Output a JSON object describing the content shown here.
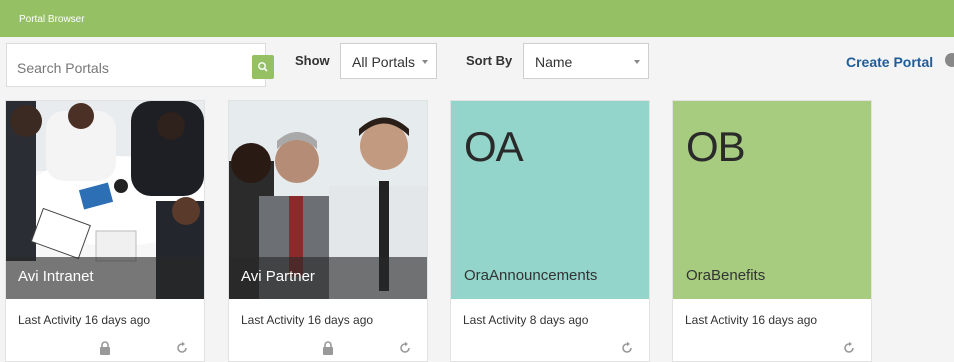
{
  "window": {
    "title": "Portal Browser"
  },
  "search": {
    "placeholder": "Search Portals",
    "value": ""
  },
  "filters": {
    "show_label": "Show",
    "show_value": "All Portals",
    "sort_label": "Sort By",
    "sort_value": "Name"
  },
  "actions": {
    "create_portal": "Create Portal"
  },
  "portals": [
    {
      "name": "Avi Intranet",
      "activity": "Last Activity 16 days ago",
      "locked": true
    },
    {
      "name": "Avi Partner",
      "activity": "Last Activity 16 days ago",
      "locked": true
    },
    {
      "initials": "OA",
      "name": "OraAnnouncements",
      "activity": "Last Activity 8 days ago",
      "locked": false,
      "color": "#93d5cb"
    },
    {
      "initials": "OB",
      "name": "OraBenefits",
      "activity": "Last Activity 16 days ago",
      "locked": false,
      "color": "#a7cc7f"
    }
  ],
  "colors": {
    "accent": "#95c064",
    "link": "#1f5c99"
  }
}
